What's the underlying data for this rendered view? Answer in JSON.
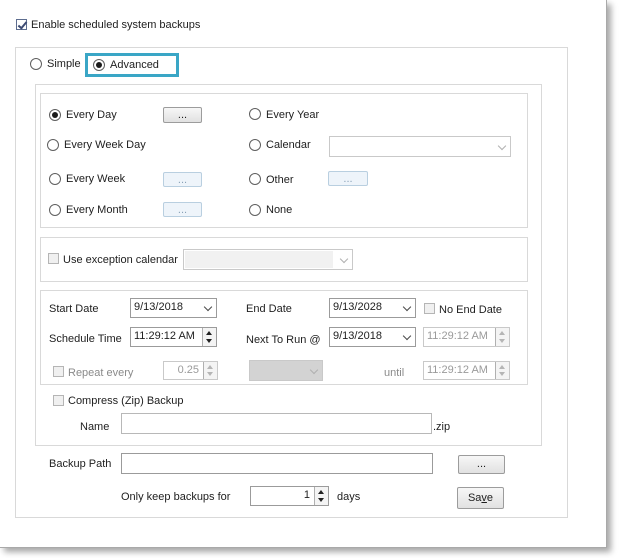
{
  "enable_backups": {
    "label": "Enable scheduled system backups",
    "checked": true
  },
  "mode": {
    "simple_label": "Simple",
    "advanced_label": "Advanced",
    "selected": "Advanced"
  },
  "frequency": {
    "every_day": "Every Day",
    "every_week_day": "Every Week Day",
    "every_week": "Every Week",
    "every_month": "Every Month",
    "every_year": "Every Year",
    "calendar": "Calendar",
    "other": "Other",
    "none": "None",
    "selected": "Every Day",
    "dots": "...",
    "calendar_value": ""
  },
  "exception": {
    "label": "Use exception calendar",
    "checked": false,
    "value": ""
  },
  "schedule": {
    "start_date_label": "Start Date",
    "start_date": "9/13/2018",
    "end_date_label": "End Date",
    "end_date": "9/13/2028",
    "no_end_date_label": "No End Date",
    "schedule_time_label": "Schedule Time",
    "schedule_time": "11:29:12 AM",
    "next_to_run_label": "Next To Run @",
    "next_to_run_date": "9/13/2018",
    "next_to_run_time": "11:29:12 AM",
    "repeat_label": "Repeat every",
    "repeat_value": "0.25",
    "until_label": "until",
    "until_time": "11:29:12 AM"
  },
  "compress": {
    "label": "Compress (Zip) Backup",
    "name_label": "Name",
    "name_value": "",
    "suffix": ".zip"
  },
  "backup_path": {
    "label": "Backup Path",
    "value": "",
    "browse_label": "..."
  },
  "keep": {
    "label": "Only keep backups for",
    "value": "1",
    "unit": "days"
  },
  "save": {
    "label_pre": "Sa",
    "label_u": "v",
    "label_post": "e"
  },
  "colors": {
    "focus_border": "#3aa6c6"
  }
}
